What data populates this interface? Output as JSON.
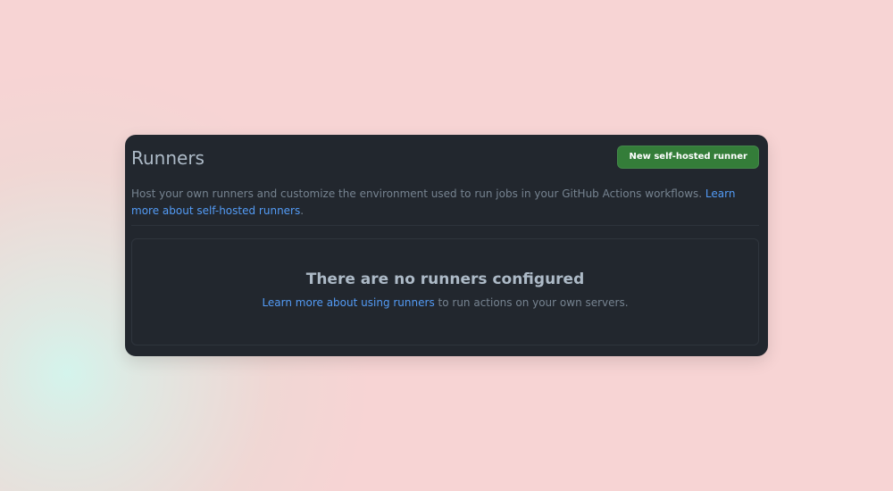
{
  "header": {
    "title": "Runners",
    "new_runner_button": "New self-hosted runner"
  },
  "description": {
    "text": "Host your own runners and customize the environment used to run jobs in your GitHub Actions workflows.",
    "link": "Learn more about self-hosted runners",
    "period": "."
  },
  "empty_state": {
    "title": "There are no runners configured",
    "link": "Learn more about using runners",
    "text": "to run actions on your own servers."
  },
  "colors": {
    "background": "#f7d4d4",
    "card": "#22272e",
    "button": "#347d39",
    "link": "#539bf5",
    "title_text": "#adbac7",
    "muted_text": "#768390"
  }
}
